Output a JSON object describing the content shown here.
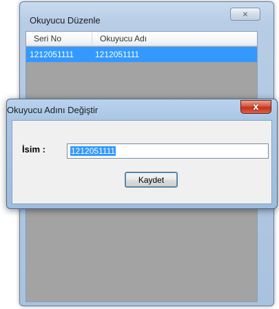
{
  "back_window": {
    "title": "Okuyucu Düzenle",
    "close_icon": "close-icon",
    "close_glyph": "⨯",
    "list": {
      "columns": [
        "Seri No",
        "Okuyucu Adı"
      ],
      "rows": [
        {
          "seri_no": "1212051111",
          "okuyucu_adi": "1212051111",
          "selected": true
        }
      ]
    }
  },
  "front_window": {
    "title": "Okuyucu Adını Değiştir",
    "close_glyph": "x",
    "name_label": "İsim :",
    "name_value": "1212051111",
    "save_label": "Kaydet"
  },
  "colors": {
    "selection": "#3399ff",
    "list_background": "#a3a3a3",
    "window_frame": "#b7cde6",
    "close_red": "#c4301a"
  }
}
